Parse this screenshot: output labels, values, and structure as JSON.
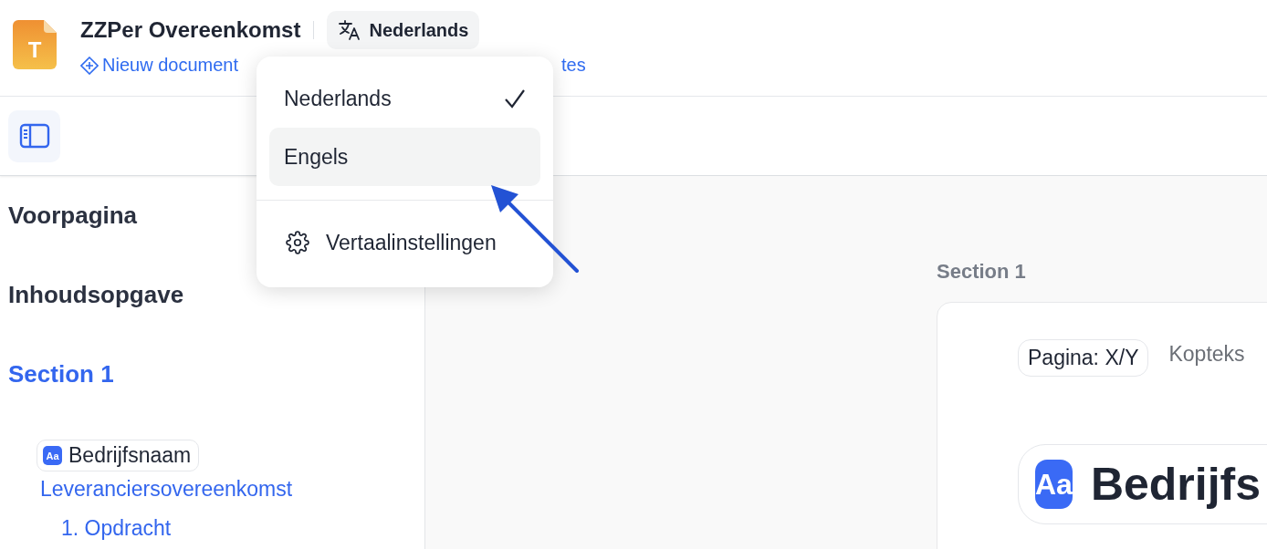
{
  "header": {
    "app_icon_letter": "T",
    "title": "ZZPer Overeenkomst",
    "language_button": "Nederlands",
    "link": "Nieuw document",
    "link_tail": "tes"
  },
  "language_menu": {
    "items": [
      {
        "label": "Nederlands",
        "selected": true,
        "highlighted": false
      },
      {
        "label": "Engels",
        "selected": false,
        "highlighted": true
      }
    ],
    "settings": "Vertaalinstellingen"
  },
  "sidebar": {
    "items": [
      {
        "kind": "heading",
        "label": "Voorpagina",
        "active": false
      },
      {
        "kind": "heading",
        "label": "Inhoudsopgave",
        "active": false
      },
      {
        "kind": "heading",
        "label": "Section 1",
        "active": true
      },
      {
        "kind": "field",
        "label": "Bedrijfsnaam",
        "icon_text": "Aa"
      },
      {
        "kind": "link",
        "label": "Leveranciersovereenkomst"
      },
      {
        "kind": "sublink",
        "label": "1. Opdracht"
      }
    ]
  },
  "document": {
    "section_label": "Section 1",
    "page_chip": "Pagina: X/Y",
    "header_text": "Kopteks",
    "field": {
      "icon_text": "Aa",
      "label": "Bedrijfs"
    }
  }
}
